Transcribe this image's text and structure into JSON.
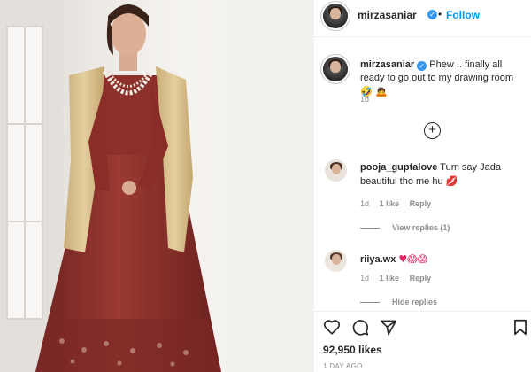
{
  "post": {
    "author": "mirzasaniar",
    "separator": "•",
    "follow_label": "Follow",
    "caption_text": "Phew .. finally all ready to go out to my drawing room",
    "caption_emojis": "🤣 🙇",
    "caption_age": "1d",
    "likes": "92,950 likes",
    "posted": "1 DAY AGO"
  },
  "comments": [
    {
      "user": "pooja_guptalove",
      "text": "Tum say Jada beautiful tho me hu",
      "emoji": "💋",
      "age": "1d",
      "likes": "1 like",
      "reply_label": "Reply",
      "view_replies": "View replies (1)"
    },
    {
      "user": "riiya.wx",
      "text": "",
      "emoji": "♥😱😱",
      "age": "1d",
      "likes": "1 like",
      "reply_label": "Reply",
      "view_replies": "Hide replies"
    }
  ],
  "colors": {
    "accent": "#0095f6",
    "verified": "#3897f0",
    "dress": "#8a2f2a",
    "jacket": "#d9c08c"
  },
  "icons": [
    "verified-badge-icon",
    "add-comment-icon",
    "heart-icon",
    "comment-icon",
    "share-icon",
    "bookmark-icon"
  ]
}
